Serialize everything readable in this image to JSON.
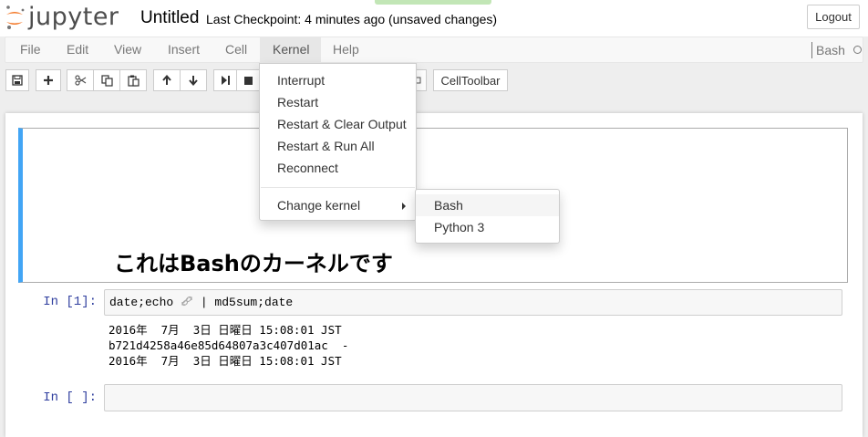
{
  "header": {
    "logo_text": "jupyter",
    "notebook_title": "Untitled",
    "checkpoint_text": "Last Checkpoint: 4 minutes ago (unsaved changes)",
    "logout_label": "Logout"
  },
  "menubar": {
    "items": [
      "File",
      "Edit",
      "View",
      "Insert",
      "Cell",
      "Kernel",
      "Help"
    ],
    "open_item": "Kernel",
    "kernel_name": "Bash",
    "kernel_status_icon": "kernel-idle-circle-icon"
  },
  "toolbar": {
    "buttons": [
      "save-icon",
      "plus-icon",
      "cut-icon",
      "copy-icon",
      "paste-icon",
      "arrow-up-icon",
      "arrow-down-icon",
      "step-forward-icon",
      "stop-icon"
    ],
    "celltoolbar_label": "CellToolbar"
  },
  "kernel_menu": {
    "items": [
      "Interrupt",
      "Restart",
      "Restart & Clear Output",
      "Restart & Run All",
      "Reconnect"
    ],
    "change_kernel_label": "Change kernel",
    "submenu": [
      "Bash",
      "Python 3"
    ],
    "submenu_highlighted": "Bash"
  },
  "cells": {
    "markdown_heading": "これはBashのカーネルです",
    "code_cell_1": {
      "prompt": "In [1]:",
      "code_before_icon": "date;echo ",
      "code_after_icon": " | md5sum;date",
      "inline_icon": "link-icon",
      "output_lines": [
        "2016年  7月  3日 日曜日 15:08:01 JST",
        "b721d4258a46e85d64807a3c407d01ac  -",
        "2016年  7月  3日 日曜日 15:08:01 JST"
      ]
    },
    "code_cell_2": {
      "prompt": "In [ ]:"
    }
  },
  "colors": {
    "accent_blue": "#42a5f5",
    "prompt_blue": "#303f9f",
    "logo_orange": "#f37726"
  }
}
